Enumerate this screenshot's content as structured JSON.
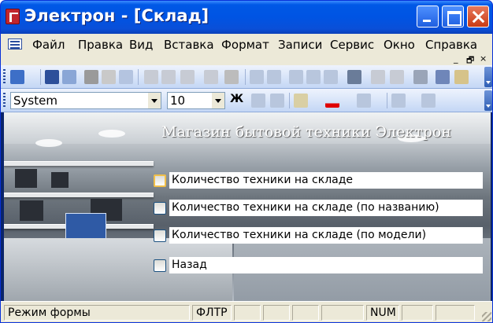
{
  "window": {
    "title": "Электрон - [Склад]"
  },
  "menu": {
    "items": [
      "Файл",
      "Правка",
      "Вид",
      "Вставка",
      "Формат",
      "Записи",
      "Сервис",
      "Окно",
      "Справка"
    ],
    "mdi_controls": [
      "_",
      "🗗",
      "×"
    ]
  },
  "format_toolbar": {
    "font": "System",
    "size": "10",
    "bold": "Ж"
  },
  "form": {
    "title": "Магазин бытовой техники Электрон",
    "options": [
      {
        "label": "Количество техники на складе",
        "focused": true
      },
      {
        "label": "Количество техники на складе (по названию)",
        "focused": false
      },
      {
        "label": "Количество техники на складе (по модели)",
        "focused": false
      },
      {
        "label": "Назад",
        "focused": false
      }
    ]
  },
  "status": {
    "mode": "Режим формы",
    "filter": "ФЛТР",
    "num": "NUM"
  },
  "colors": {
    "titlebar": "#0054e3",
    "toolbar": "#c4d7f5",
    "chrome": "#ece9d8"
  }
}
